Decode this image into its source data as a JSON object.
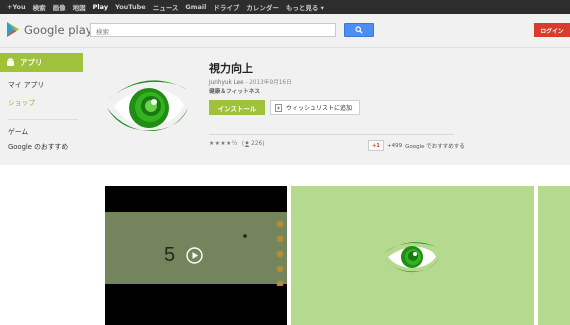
{
  "topbar": {
    "items": [
      "+You",
      "検索",
      "画像",
      "地図",
      "Play",
      "YouTube",
      "ニュース",
      "Gmail",
      "ドライブ",
      "カレンダー",
      "もっと見る ▾"
    ]
  },
  "header": {
    "logo_text": "Google play",
    "search_placeholder": "検索",
    "login_label": "ログイン"
  },
  "sidebar": {
    "apps_label": "アプリ",
    "my_apps": "マイ アプリ",
    "shop": "ショップ",
    "games": "ゲーム",
    "recommended": "Google のおすすめ"
  },
  "app": {
    "title": "視力向上",
    "author": "Junhyuk Lee",
    "date": " - 2013年9月16日",
    "category": "健康＆フィットネス",
    "install_label": "インストール",
    "wishlist_label": "ウィッシュリストに追加",
    "stars": "★★★★½",
    "rating_count": "226",
    "plus_label": "+1",
    "plus_count": "+499",
    "plus_text": "Google でおすすめする"
  },
  "screenshot": {
    "counter": "5"
  },
  "colors": {
    "accent_green": "#9fc13c",
    "search_blue": "#4c8ef4",
    "login_red": "#d93c2c",
    "eye_green": "#1f8d16"
  }
}
